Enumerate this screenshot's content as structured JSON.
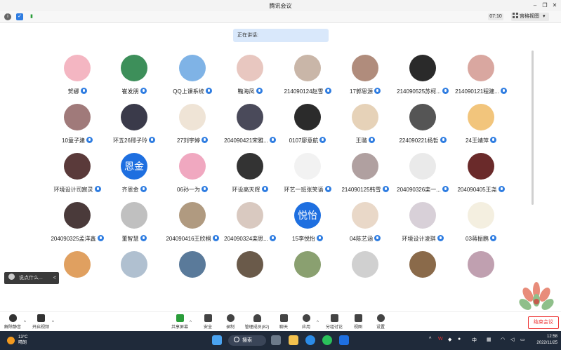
{
  "window": {
    "title": "腾讯会议",
    "minimize": "–",
    "maximize": "❐",
    "close": "✕"
  },
  "toolbar": {
    "timer": "07:10",
    "view_label": "宫格视图",
    "view_caret": "▾"
  },
  "speaking": {
    "label": "正在讲话:"
  },
  "participants": [
    {
      "name": "贺娜",
      "avatar": ""
    },
    {
      "name": "崔发朋",
      "avatar": ""
    },
    {
      "name": "QQ上课系统",
      "avatar": ""
    },
    {
      "name": "鞠海凤",
      "avatar": ""
    },
    {
      "name": "214090124赵雪",
      "avatar": ""
    },
    {
      "name": "17郭思源",
      "avatar": ""
    },
    {
      "name": "214090525苏柯...",
      "avatar": ""
    },
    {
      "name": "214090121程建...",
      "avatar": ""
    },
    {
      "name": "10童子建",
      "avatar": ""
    },
    {
      "name": "环五26邢子玲",
      "avatar": ""
    },
    {
      "name": "27刘宇婷",
      "avatar": ""
    },
    {
      "name": "204090421宋雅...",
      "avatar": ""
    },
    {
      "name": "0107廖意航",
      "avatar": ""
    },
    {
      "name": "王璐",
      "avatar": ""
    },
    {
      "name": "224090221杨哲",
      "avatar": ""
    },
    {
      "name": "24王靖萍",
      "avatar": ""
    },
    {
      "name": "环境设计司宸灵",
      "avatar": ""
    },
    {
      "name": "齐恩金",
      "avatar": "恩金"
    },
    {
      "name": "06孙一为",
      "avatar": ""
    },
    {
      "name": "环设高天辉",
      "avatar": ""
    },
    {
      "name": "环艺一班张笑语",
      "avatar": ""
    },
    {
      "name": "214090125韩雪",
      "avatar": ""
    },
    {
      "name": "204090326栾一...",
      "avatar": ""
    },
    {
      "name": "204090405王尧",
      "avatar": ""
    },
    {
      "name": "204090325孟洋鑫",
      "avatar": ""
    },
    {
      "name": "董智慧",
      "avatar": ""
    },
    {
      "name": "204090416王欣桐",
      "avatar": ""
    },
    {
      "name": "204090324栾思...",
      "avatar": ""
    },
    {
      "name": "15李悦怡",
      "avatar": "悦怡"
    },
    {
      "name": "04陈艺涵",
      "avatar": ""
    },
    {
      "name": "环境设计凌琪",
      "avatar": ""
    },
    {
      "name": "03蒋振鹏",
      "avatar": ""
    },
    {
      "name": "",
      "avatar": ""
    },
    {
      "name": "",
      "avatar": ""
    },
    {
      "name": "",
      "avatar": ""
    },
    {
      "name": "",
      "avatar": ""
    },
    {
      "name": "",
      "avatar": ""
    },
    {
      "name": "",
      "avatar": ""
    },
    {
      "name": "",
      "avatar": ""
    },
    {
      "name": "",
      "avatar": ""
    }
  ],
  "chat": {
    "placeholder": "说点什么...",
    "collapse": "<"
  },
  "meetbar": {
    "mute": "解除静音",
    "video": "开启视频",
    "share": "共享屏幕",
    "security": "安全",
    "record": "录制",
    "manage": "管理成员(82)",
    "chat": "聊天",
    "apps": "应用",
    "breakout": "分组讨论",
    "view": "视图",
    "settings": "设置",
    "leave": "结束会议"
  },
  "taskbar": {
    "temp": "13°C",
    "weather": "晴朗",
    "search": "搜索",
    "ime": "中",
    "time": "12:58",
    "date": "2022/11/25"
  },
  "colors": {
    "accent": "#1e6fe0",
    "mic": "#2f7de1",
    "leave": "#e33333",
    "taskbar": "#1f2a3a"
  }
}
